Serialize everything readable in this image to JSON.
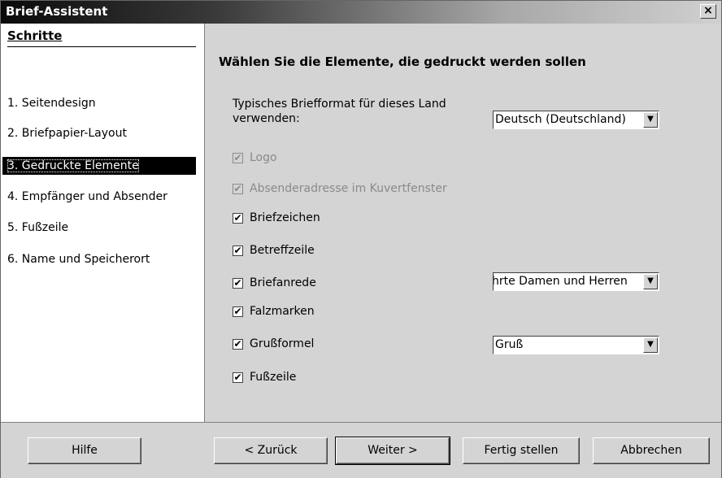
{
  "window": {
    "title": "Brief-Assistent",
    "close_glyph": "×"
  },
  "sidebar": {
    "header": "Schritte",
    "steps": [
      "1.  Seitendesign",
      "2.  Briefpapier-Layout",
      "3.  Gedruckte Elemente",
      "4.  Empfänger und Absender",
      "5.  Fußzeile",
      "6.  Name und Speicherort"
    ],
    "selected_index": 2
  },
  "main": {
    "heading": "Wählen Sie die Elemente, die gedruckt werden sollen",
    "format_label_line1": "Typisches Briefformat für dieses Land",
    "format_label_line2": "verwenden:",
    "format_select": "Deutsch (Deutschland)",
    "salutation_select": "hrte Damen und Herren",
    "closing_select": "Gruß",
    "checkboxes": [
      {
        "label": "Logo",
        "checked": true,
        "disabled": true
      },
      {
        "label": "Absenderadresse im Kuvertfenster",
        "checked": true,
        "disabled": true
      },
      {
        "label": "Briefzeichen",
        "checked": true,
        "disabled": false
      },
      {
        "label": "Betreffzeile",
        "checked": true,
        "disabled": false
      },
      {
        "label": "Briefanrede",
        "checked": true,
        "disabled": false
      },
      {
        "label": "Falzmarken",
        "checked": true,
        "disabled": false
      },
      {
        "label": "Grußformel",
        "checked": true,
        "disabled": false
      },
      {
        "label": "Fußzeile",
        "checked": true,
        "disabled": false
      }
    ]
  },
  "buttons": {
    "help": "Hilfe",
    "back": "< Zurück",
    "next": "Weiter >",
    "finish": "Fertig stellen",
    "cancel": "Abbrechen"
  },
  "icons": {
    "checkmark": "✔",
    "dropdown_arrow": "▼"
  }
}
